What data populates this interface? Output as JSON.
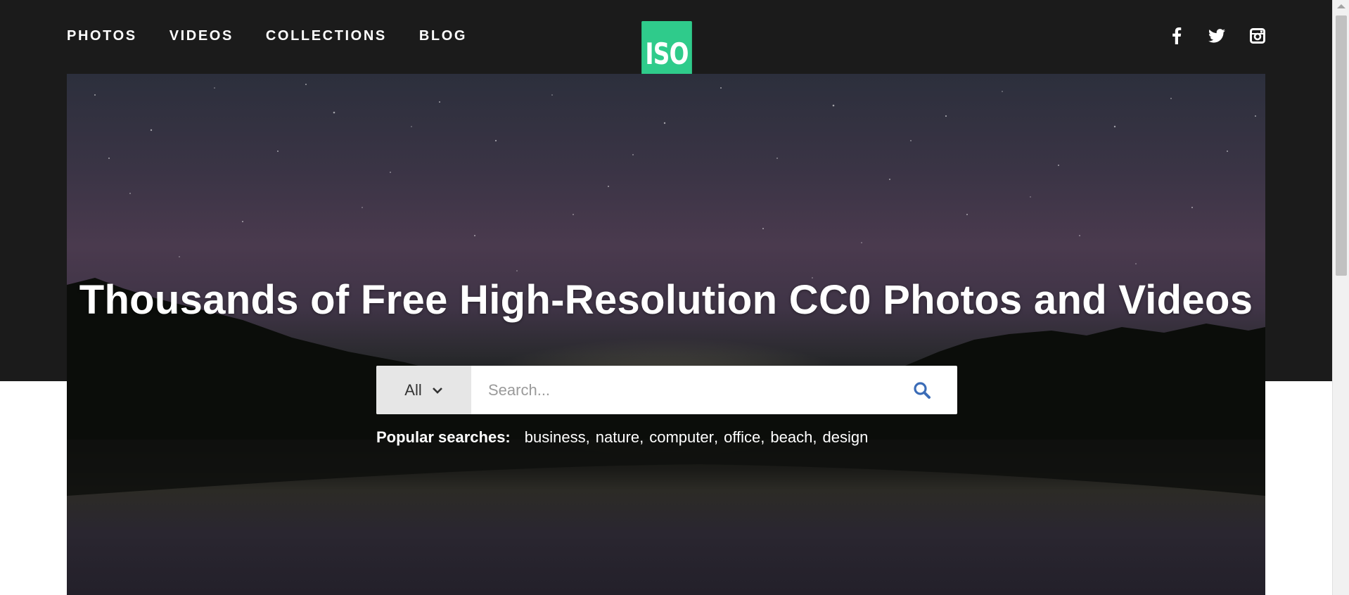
{
  "nav": {
    "items": [
      {
        "label": "PHOTOS"
      },
      {
        "label": "VIDEOS"
      },
      {
        "label": "COLLECTIONS"
      },
      {
        "label": "BLOG"
      }
    ]
  },
  "logo": {
    "text": "ISO",
    "color": "#2fcb8b"
  },
  "social": {
    "icons": [
      "facebook-icon",
      "twitter-icon",
      "instagram-icon"
    ]
  },
  "hero": {
    "title": "Thousands of Free High-Resolution CC0 Photos and Videos"
  },
  "search": {
    "type_selected": "All",
    "placeholder": "Search...",
    "button_icon": "search-icon"
  },
  "popular": {
    "label": "Popular searches:",
    "terms": [
      "business",
      "nature",
      "computer",
      "office",
      "beach",
      "design"
    ],
    "separator": ","
  },
  "colors": {
    "header_bg": "#1b1b1b",
    "accent": "#2fcb8b",
    "search_icon": "#3b6cb7"
  }
}
